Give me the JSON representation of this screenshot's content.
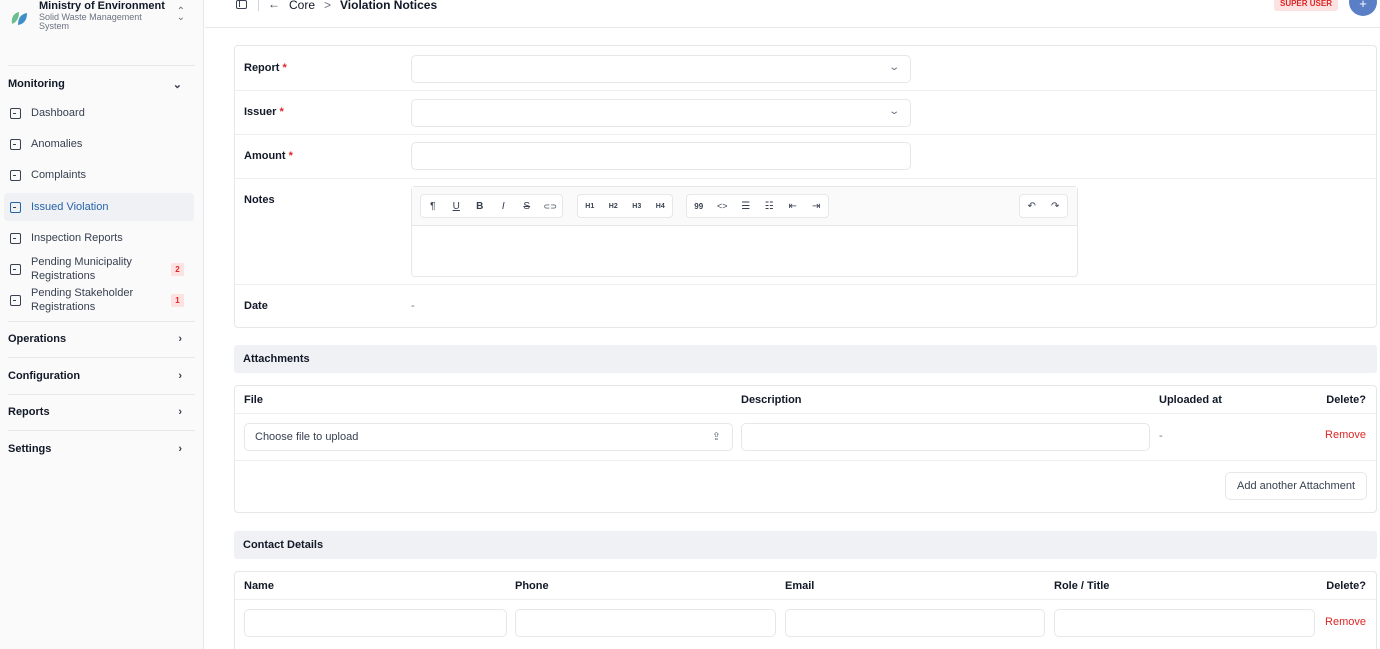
{
  "org": {
    "name": "Ministry of Environment",
    "subtitle": "Solid Waste Management System"
  },
  "sidebar": {
    "monitoring_label": "Monitoring",
    "items": [
      {
        "label": "Dashboard"
      },
      {
        "label": "Anomalies"
      },
      {
        "label": "Complaints"
      },
      {
        "label": "Issued Violation",
        "active": true
      },
      {
        "label": "Inspection Reports"
      },
      {
        "label": "Pending Municipality Registrations",
        "badge": "2"
      },
      {
        "label": "Pending Stakeholder Registrations",
        "badge": "1"
      }
    ],
    "groups": [
      {
        "label": "Operations"
      },
      {
        "label": "Configuration"
      },
      {
        "label": "Reports"
      },
      {
        "label": "Settings"
      }
    ]
  },
  "topbar": {
    "back_arrow": "←",
    "breadcrumb_core": "Core",
    "breadcrumb_sep": ">",
    "breadcrumb_page": "Violation Notices",
    "role_badge": "SUPER USER",
    "avatar_glyph": "+"
  },
  "form": {
    "report_label": "Report",
    "issuer_label": "Issuer",
    "amount_label": "Amount",
    "notes_label": "Notes",
    "date_label": "Date",
    "date_value": "-",
    "required_mark": "*"
  },
  "editor": {
    "toolbar_groups": [
      [
        "¶",
        "U",
        "B",
        "I",
        "S",
        "⊂⊃"
      ],
      [
        "H1",
        "H2",
        "H3",
        "H4"
      ],
      [
        "99",
        "<>",
        "☰",
        "☷",
        "⇤",
        "⇥"
      ],
      [
        "↶",
        "↷"
      ]
    ],
    "toolbar_names": [
      [
        "paragraph-icon",
        "underline-icon",
        "bold-icon",
        "italic-icon",
        "strikethrough-icon",
        "link-icon"
      ],
      [
        "heading1-icon",
        "heading2-icon",
        "heading3-icon",
        "heading4-icon"
      ],
      [
        "blockquote-icon",
        "code-icon",
        "bullet-list-icon",
        "ordered-list-icon",
        "outdent-icon",
        "indent-icon"
      ],
      [
        "undo-icon",
        "redo-icon"
      ]
    ]
  },
  "attachments": {
    "title": "Attachments",
    "col_file": "File",
    "col_description": "Description",
    "col_uploaded": "Uploaded at",
    "col_delete": "Delete?",
    "file_placeholder": "Choose file to upload",
    "uploaded_value": "-",
    "remove_label": "Remove",
    "add_label": "Add another Attachment"
  },
  "contacts": {
    "title": "Contact Details",
    "col_name": "Name",
    "col_phone": "Phone",
    "col_email": "Email",
    "col_role": "Role / Title",
    "col_delete": "Delete?",
    "remove_label": "Remove"
  },
  "colors": {
    "accent": "#2563a8",
    "danger": "#dc2626",
    "avatar": "#5b7fc7"
  }
}
